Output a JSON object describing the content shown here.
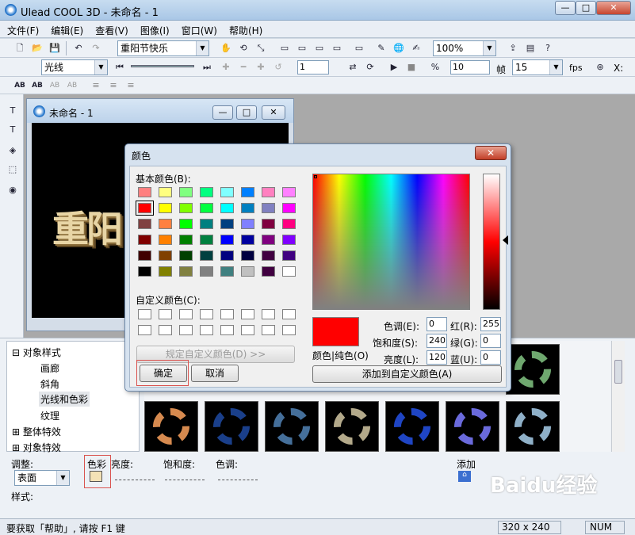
{
  "window": {
    "title": "Ulead COOL 3D - 未命名 - 1",
    "min": "—",
    "max": "□",
    "close": "✕"
  },
  "menu": [
    "文件(F)",
    "编辑(E)",
    "查看(V)",
    "图像(I)",
    "窗口(W)",
    "帮助(H)"
  ],
  "toolbar1": {
    "text_combo": "重阳节快乐",
    "zoom_combo": "100%"
  },
  "toolbar2": {
    "effect_combo": "光线",
    "frame_value": "1",
    "frames_value": "10",
    "frames_label": "帧",
    "fps_value": "15",
    "fps_label": "fps",
    "x_label": "X:"
  },
  "toolbar3": {
    "buttons": [
      "AB",
      "AB",
      "AB",
      "AB"
    ]
  },
  "child_window": {
    "title": "未命名 - 1",
    "canvas_text": "重阳"
  },
  "tree": {
    "items": [
      {
        "label": "对象样式",
        "expander": "⊟"
      },
      {
        "label": "画廊"
      },
      {
        "label": "斜角"
      },
      {
        "label": "光线和色彩"
      },
      {
        "label": "纹理"
      },
      {
        "label": "整体特效",
        "expander": "⊞"
      },
      {
        "label": "对象特效",
        "expander": "⊞"
      }
    ]
  },
  "adjust": {
    "label": "调整:",
    "combo": "表面",
    "color_label": "色彩",
    "brightness_label": "亮度:",
    "saturation_label": "饱和度:",
    "hue_label": "色调:",
    "add_label": "添加",
    "style_label": "样式:"
  },
  "status": {
    "text": "要获取「帮助」, 请按 F1 键",
    "size": "320 x 240",
    "num": "NUM"
  },
  "watermark": "Baidu经验",
  "color_dialog": {
    "title": "颜色",
    "close": "✕",
    "basic_label": "基本颜色(B):",
    "custom_label": "自定义颜色(C):",
    "define_button": "规定自定义颜色(D) >>",
    "ok_button": "确定",
    "cancel_button": "取消",
    "add_custom_button": "添加到自定义颜色(A)",
    "solid_label": "颜色|纯色(O)",
    "hue_label": "色调(E):",
    "hue_value": "0",
    "sat_label": "饱和度(S):",
    "sat_value": "240",
    "lum_label": "亮度(L):",
    "lum_value": "120",
    "red_label": "红(R):",
    "red_value": "255",
    "green_label": "绿(G):",
    "green_value": "0",
    "blue_label": "蓝(U):",
    "blue_value": "0",
    "selected_color": "#ff0000",
    "basic_colors": [
      [
        "#ff8080",
        "#ffff80",
        "#80ff80",
        "#00ff80",
        "#80ffff",
        "#0080ff",
        "#ff80c0",
        "#ff80ff"
      ],
      [
        "#ff0000",
        "#ffff00",
        "#80ff00",
        "#00ff40",
        "#00ffff",
        "#0080c0",
        "#8080c0",
        "#ff00ff"
      ],
      [
        "#804040",
        "#ff8040",
        "#00ff00",
        "#008080",
        "#004080",
        "#8080ff",
        "#800040",
        "#ff0080"
      ],
      [
        "#800000",
        "#ff8000",
        "#008000",
        "#008040",
        "#0000ff",
        "#0000a0",
        "#800080",
        "#8000ff"
      ],
      [
        "#400000",
        "#804000",
        "#004000",
        "#004040",
        "#000080",
        "#000040",
        "#400040",
        "#400080"
      ],
      [
        "#000000",
        "#808000",
        "#808040",
        "#808080",
        "#408080",
        "#c0c0c0",
        "#400040",
        "#ffffff"
      ]
    ]
  },
  "thumb_colors": [
    "#d68a4f",
    "#1a3f8a",
    "#456f9a",
    "#b3a98a",
    "#1f45c4",
    "#6a6adc",
    "#8fb0c8",
    "#6fa86f"
  ]
}
